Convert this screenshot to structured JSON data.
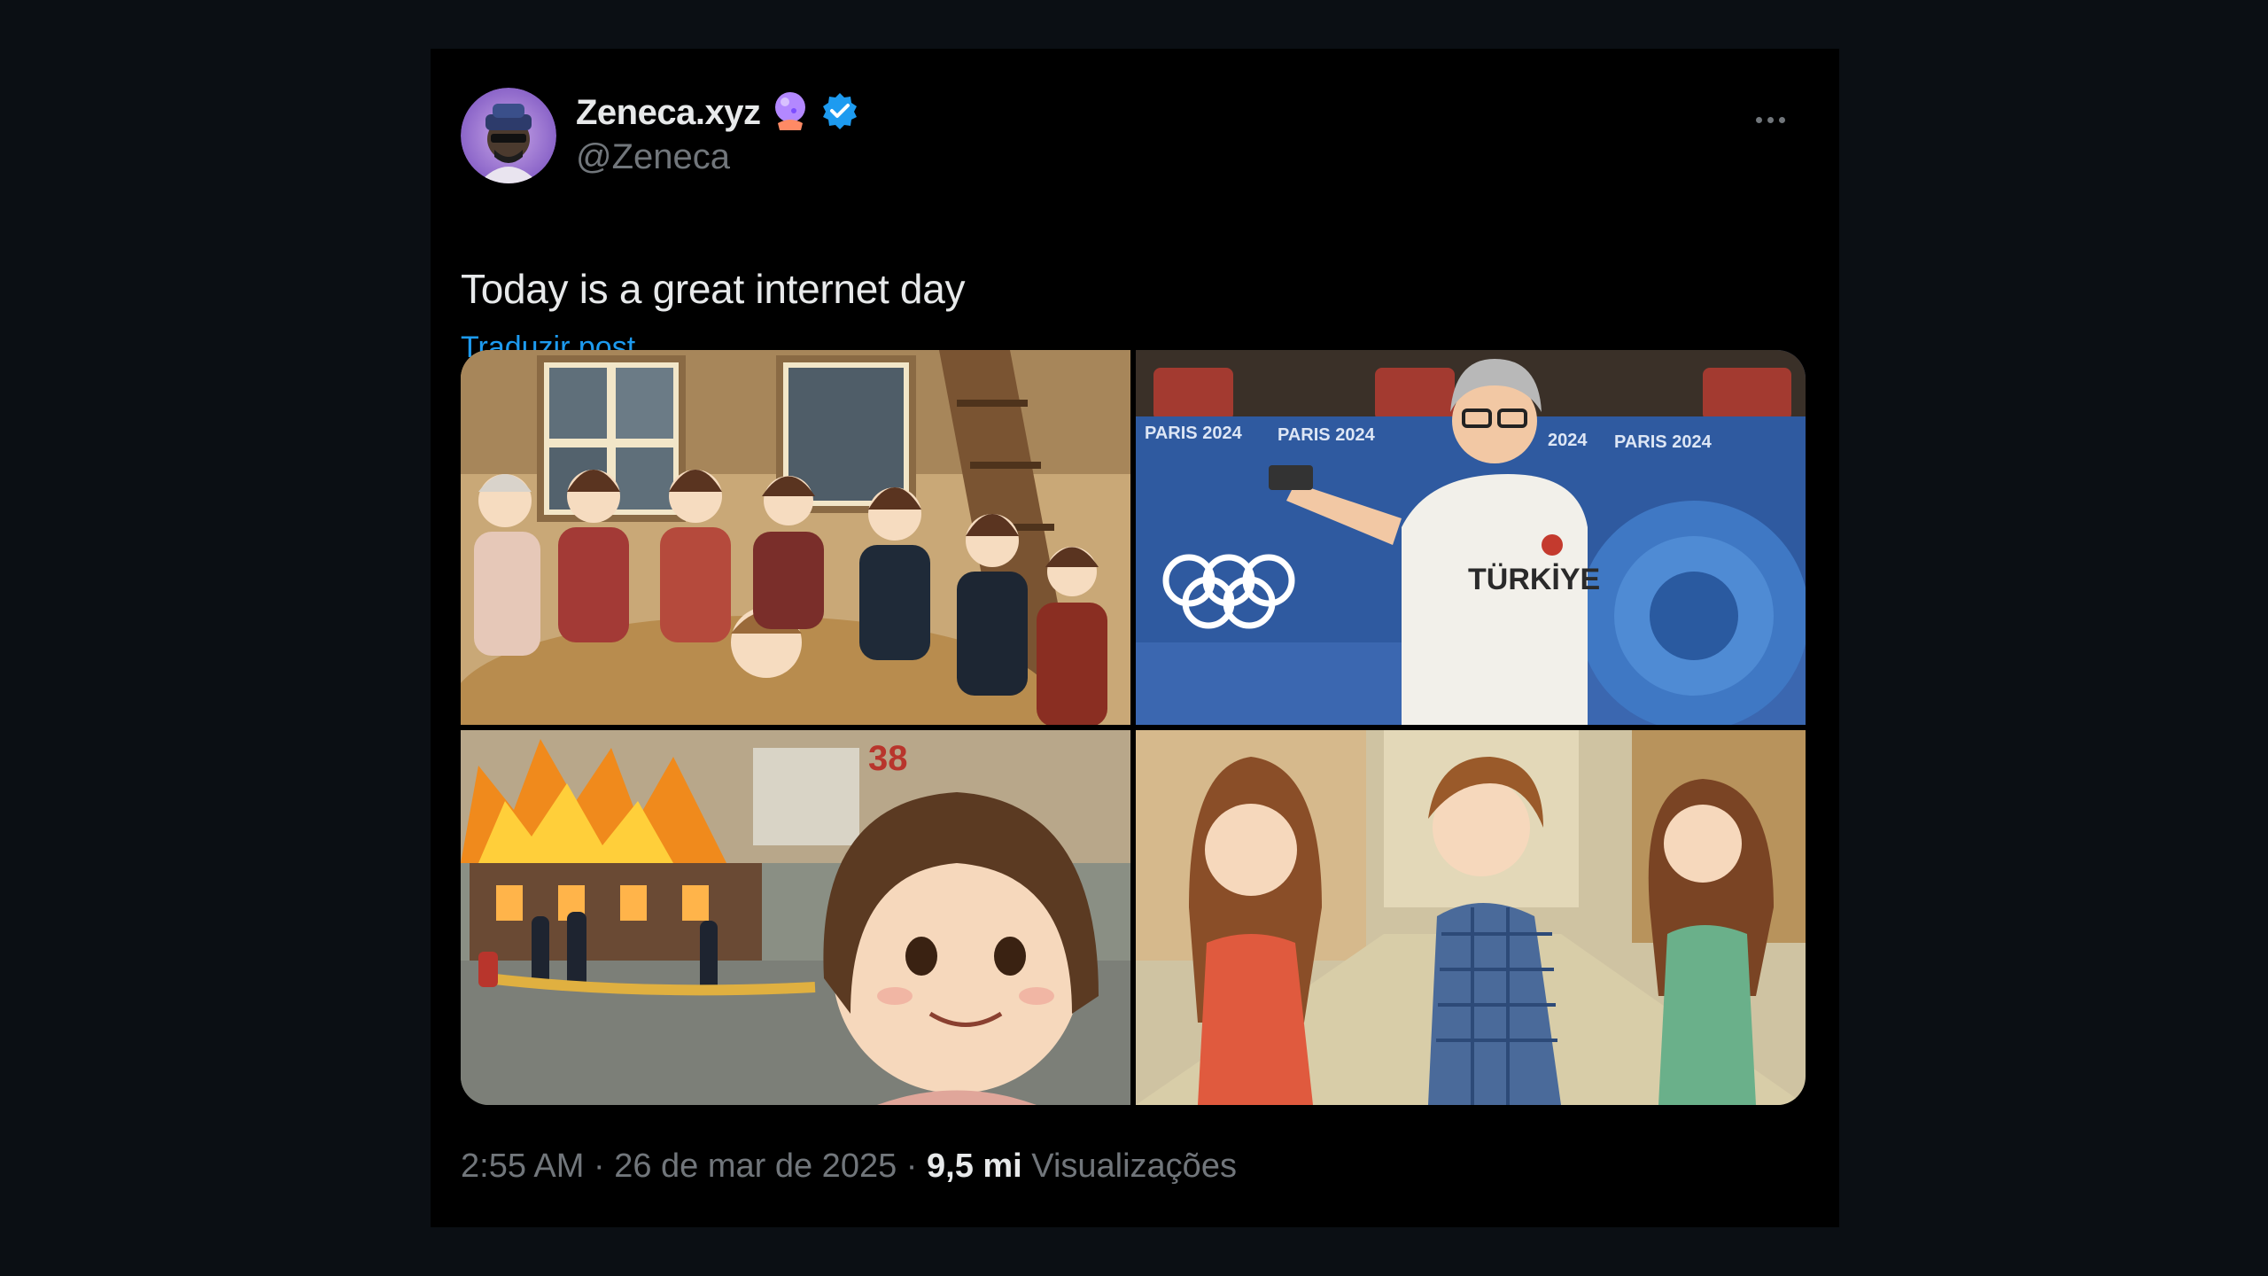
{
  "tweet": {
    "author": {
      "display_name": "Zeneca.xyz",
      "handle": "@Zeneca",
      "emoji_icon": "crystal-ball-icon",
      "verified_icon": "verified-badge-icon"
    },
    "text": "Today is a great internet day",
    "translate_label": "Traduzir post",
    "media": [
      {
        "icon": "family-dinner-image",
        "caption": ""
      },
      {
        "icon": "olympic-shooter-image",
        "banner_text": [
          "PARIS 2024",
          "PARIS 2024",
          "2024",
          "PARIS 2024"
        ],
        "jersey_text": "TÜRKİYE"
      },
      {
        "icon": "burning-house-girl-image",
        "caption": "38"
      },
      {
        "icon": "distracted-boyfriend-image",
        "caption": ""
      }
    ],
    "meta": {
      "time": "2:55 AM",
      "separator": " · ",
      "date": "26 de mar de 2025",
      "views_count": "9,5 mi",
      "views_label": "Visualizações"
    }
  },
  "colors": {
    "background": "#0b0f14",
    "card": "#000000",
    "primary_text": "#e7e9ea",
    "secondary_text": "#71767b",
    "link": "#1d9bf0",
    "verified": "#1d9bf0"
  }
}
